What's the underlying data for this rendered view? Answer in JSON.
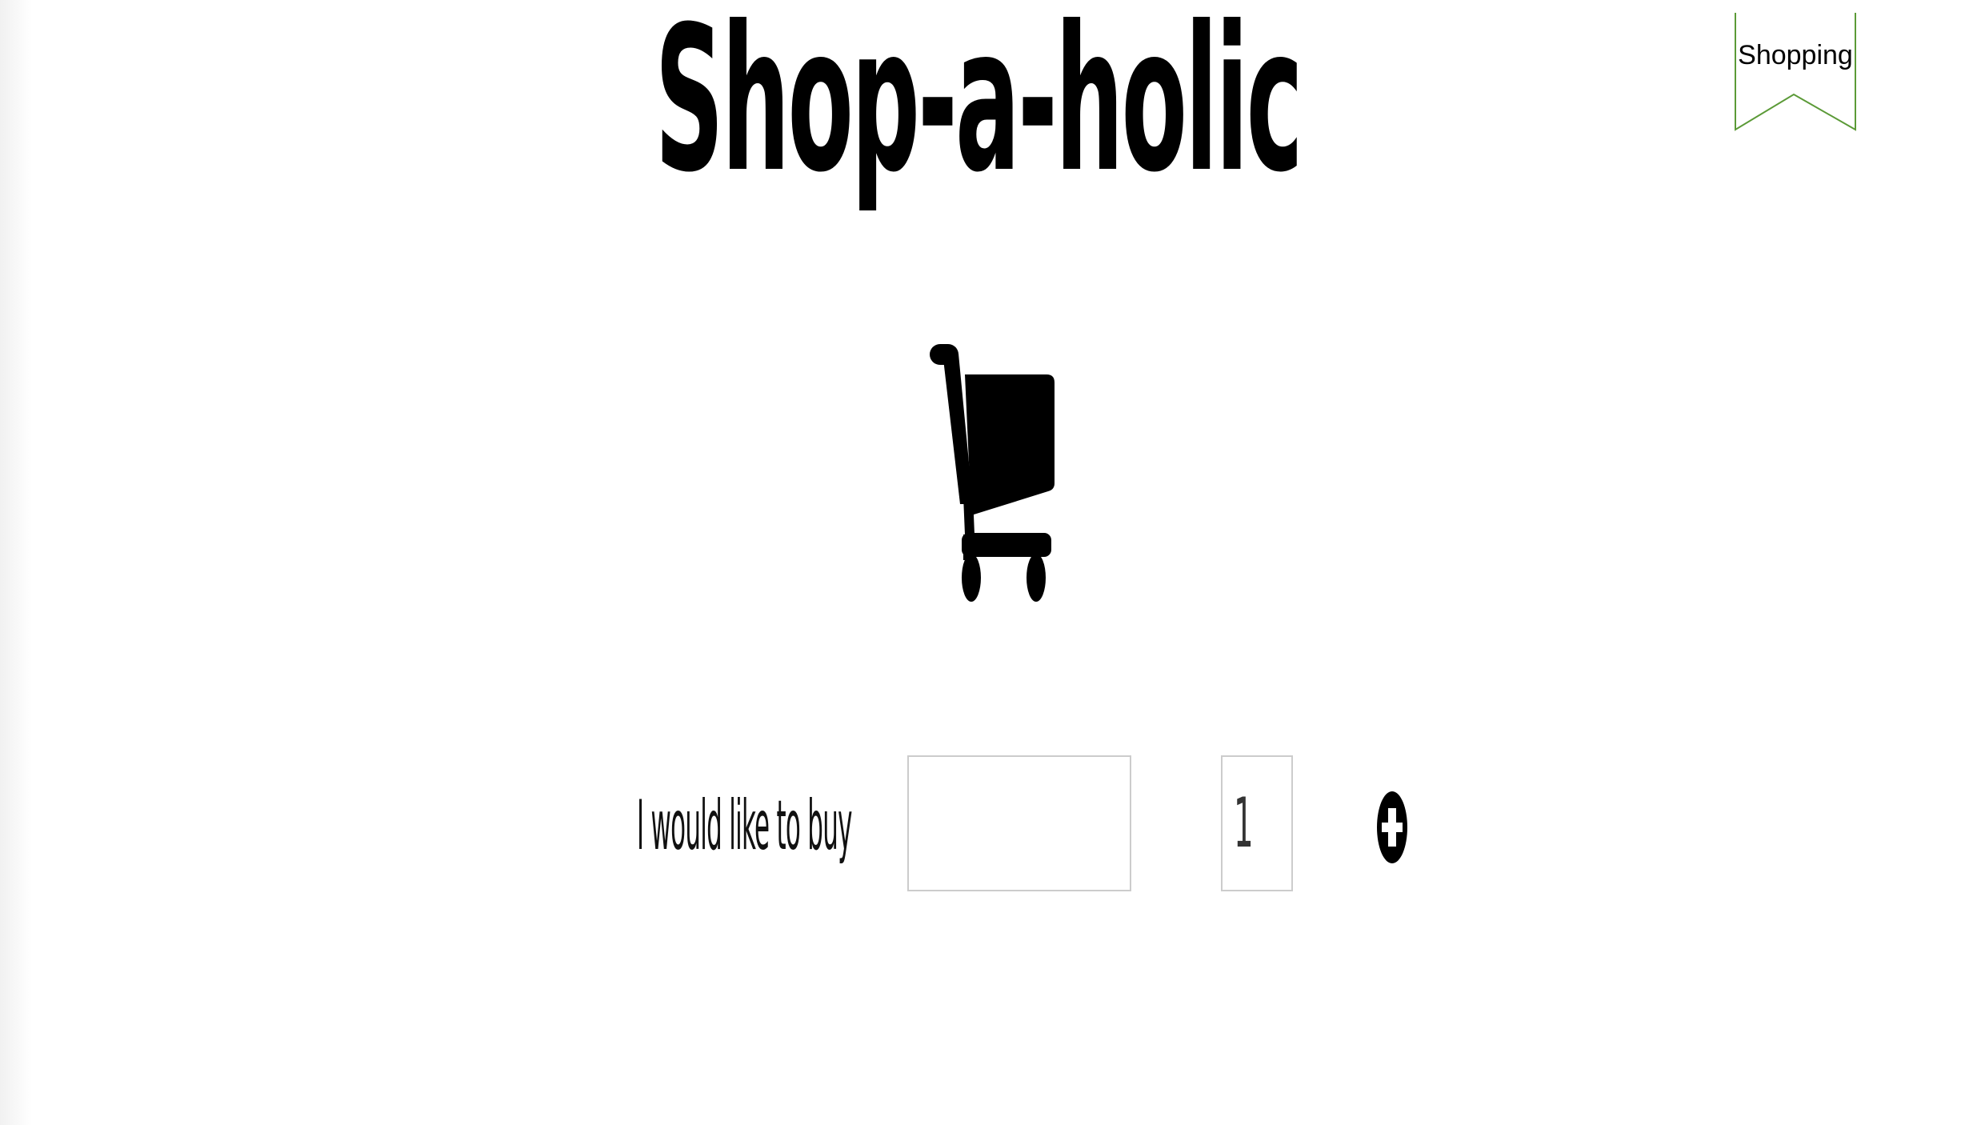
{
  "header": {
    "title": "Shop-a-holic"
  },
  "ribbon": {
    "label": "Shopping",
    "color": "#5b9a37"
  },
  "cart": {
    "icon": "shopping-cart-icon"
  },
  "form": {
    "label": "I would like to buy",
    "item_value": "",
    "quantity": "1",
    "add_icon": "plus-circle-icon"
  }
}
